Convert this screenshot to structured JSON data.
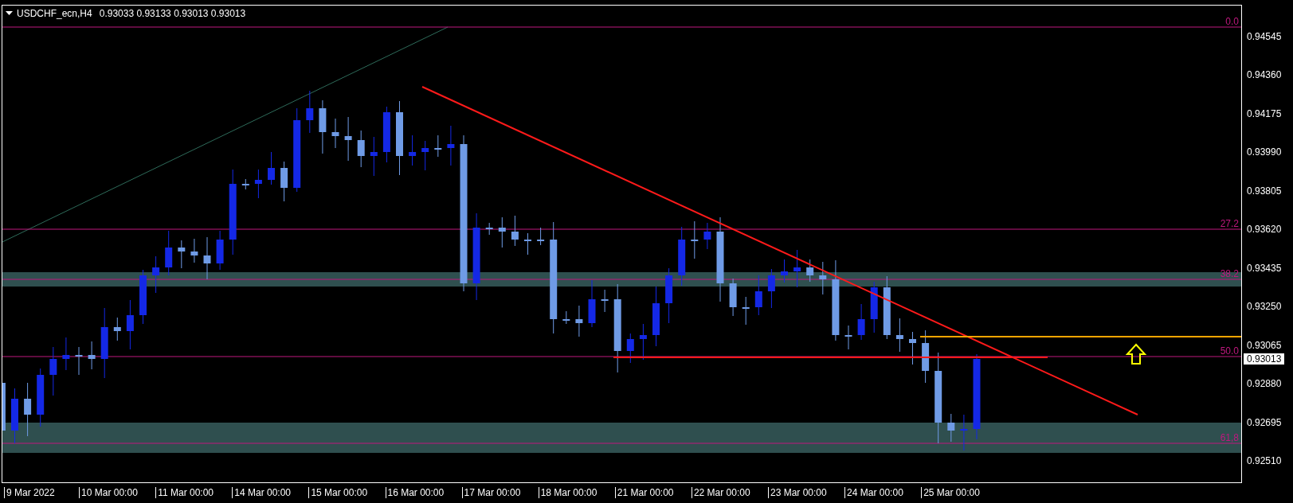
{
  "header": {
    "symbol": "USDCHF_ecn,H4",
    "quote": "0.93033 0.93133 0.93013 0.93013"
  },
  "price_axis": [
    "0.94545",
    "0.94360",
    "0.94175",
    "0.93990",
    "0.93805",
    "0.93620",
    "0.93435",
    "0.93250",
    "0.93065",
    "0.92880",
    "0.92695",
    "0.92510"
  ],
  "current_price": "0.93013",
  "fib_levels": [
    {
      "label": "0.0"
    },
    {
      "label": "27.2"
    },
    {
      "label": "38.2"
    },
    {
      "label": "50.0"
    },
    {
      "label": "61,8"
    }
  ],
  "time_axis": [
    "9 Mar 2022",
    "10 Mar 00:00",
    "11 Mar 00:00",
    "14 Mar 00:00",
    "15 Mar 00:00",
    "16 Mar 00:00",
    "17 Mar 00:00",
    "18 Mar 00:00",
    "21 Mar 00:00",
    "22 Mar 00:00",
    "23 Mar 00:00",
    "24 Mar 00:00",
    "25 Mar 00:00"
  ]
}
